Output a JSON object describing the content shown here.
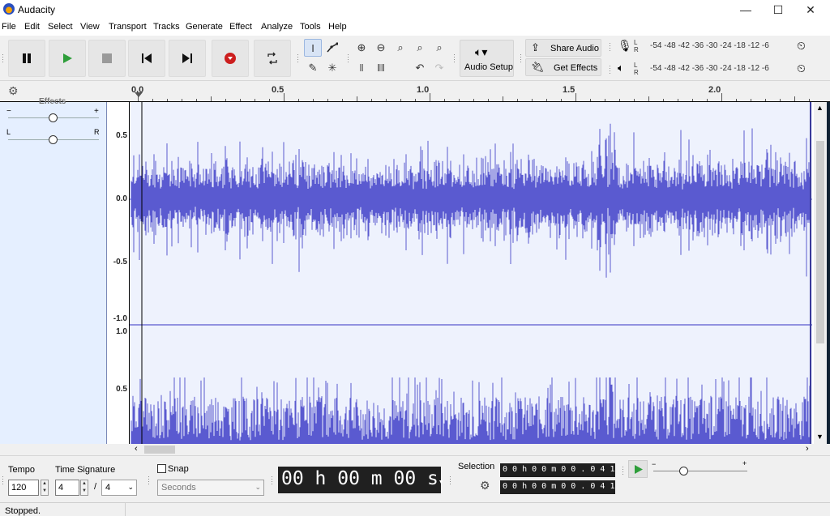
{
  "window": {
    "title": "Audacity",
    "minimize_glyph": "—",
    "maximize_glyph": "☐",
    "close_glyph": "✕"
  },
  "menu": [
    "File",
    "Edit",
    "Select",
    "View",
    "Transport",
    "Tracks",
    "Generate",
    "Effect",
    "Analyze",
    "Tools",
    "Help"
  ],
  "toolbar": {
    "audio_setup_label": "Audio Setup",
    "share_audio_label": "Share Audio",
    "get_effects_label": "Get Effects",
    "meter_scale": [
      "-54",
      "-48",
      "-42",
      "-36",
      "-30",
      "-24",
      "-18",
      "-12",
      "-6"
    ],
    "meter_lr": [
      "L",
      "R"
    ]
  },
  "ruler": {
    "labels": [
      "0.0",
      "0.5",
      "1.0",
      "1.5",
      "2.0"
    ]
  },
  "track_panel": {
    "gain_minus": "−",
    "gain_plus": "+",
    "pan_left": "L",
    "pan_right": "R",
    "header_label": "Effects"
  },
  "vertical_ruler": {
    "channel1": [
      "0.5",
      "0.0",
      "-0.5",
      "-1.0"
    ],
    "channel2": [
      "1.0",
      "0.5"
    ]
  },
  "bottom": {
    "tempo_label": "Tempo",
    "tempo_value": "120",
    "time_signature_label": "Time Signature",
    "time_sig_numerator": "4",
    "time_sig_separator": "/",
    "time_sig_denominator": "4",
    "snap_label": "Snap",
    "snap_unit": "Seconds",
    "big_time": "00 h 00 m 00 s",
    "selection_label": "Selection",
    "selection_start": "0 0 h 0 0 m 0 0 . 0 4 1  s",
    "selection_end": "0 0 h 0 0 m 0 0 . 0 4 1  s",
    "play_speed_minus": "−",
    "play_speed_plus": "+"
  },
  "status": {
    "text": "Stopped."
  },
  "colors": {
    "waveform": "#5a5ad0",
    "wave_bg": "#eef2fd",
    "track_panel": "#e5efff",
    "record_red": "#cc1e1e",
    "play_green": "#2e9e3a"
  }
}
